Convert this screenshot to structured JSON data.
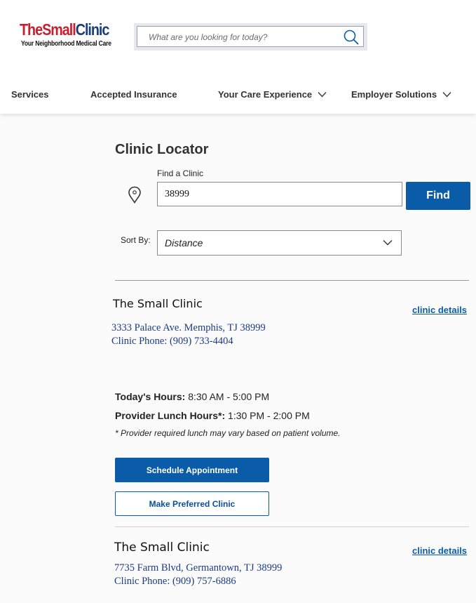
{
  "header": {
    "logo": {
      "part1": "The",
      "part2": "Small",
      "part3": "Clinic",
      "tagline": "Your Neighborhood Medical Care"
    },
    "search": {
      "placeholder": "What are you looking for today?",
      "icon": "search-icon"
    }
  },
  "nav": {
    "items": [
      {
        "label": "Services"
      },
      {
        "label": "Accepted Insurance"
      },
      {
        "label": "Your Care Experience"
      },
      {
        "label": "Employer Solutions"
      }
    ]
  },
  "locator": {
    "title": "Clinic Locator",
    "find_label": "Find a Clinic",
    "zip_value": "38999",
    "find_button": "Find",
    "sort_label": "Sort By:",
    "sort_value": "Distance"
  },
  "clinics": [
    {
      "name": "The Small Clinic",
      "details_link": "clinic details",
      "address": "3333 Palace Ave. Memphis, TJ 38999",
      "phone": "Clinic Phone: (909) 733-4404",
      "todays_hours_label": "Today's Hours:",
      "todays_hours_value": " 8:30 AM - 5:00 PM",
      "lunch_label": "Provider Lunch Hours*:",
      "lunch_value": " 1:30 PM - 2:00 PM",
      "note": "* Provider required lunch may vary based on patient volume.",
      "schedule_button": "Schedule Appointment",
      "preferred_button": "Make Preferred Clinic"
    },
    {
      "name": "The Small Clinic",
      "details_link": "clinic details",
      "address": "7735 Farm Blvd, Germantown, TJ 38999",
      "phone": "Clinic Phone: (909) 757-6886"
    }
  ],
  "colors": {
    "brand_red": "#c8202f",
    "brand_navy": "#1a3e7a",
    "primary_blue": "#0a5ca8",
    "address_blue": "#1a3a86"
  }
}
